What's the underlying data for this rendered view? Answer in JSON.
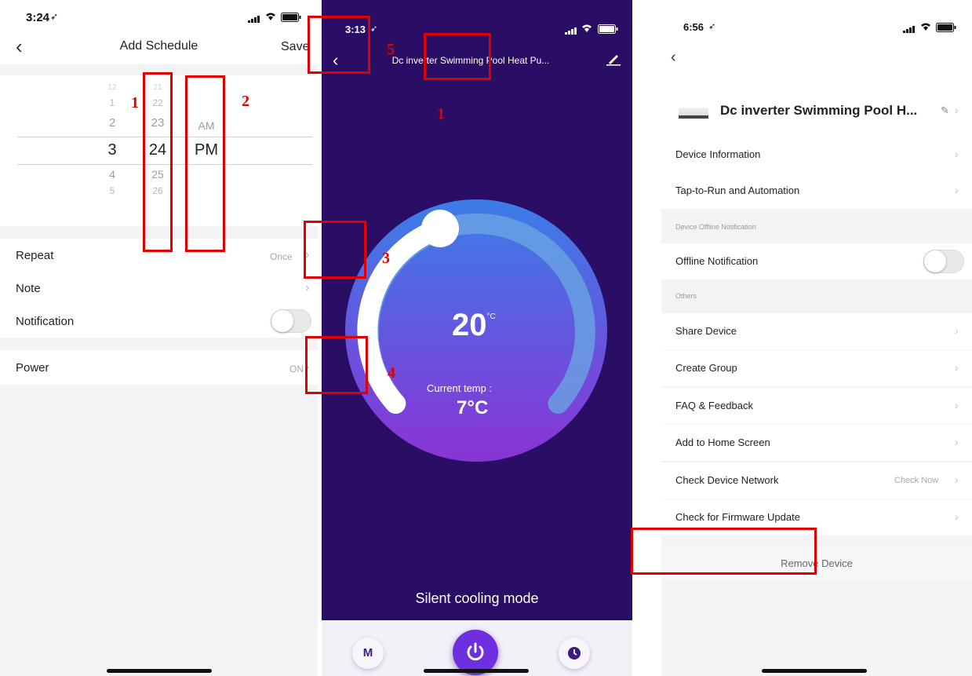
{
  "schedule_screen": {
    "status_time": "3:24",
    "title": "Add Schedule",
    "save_label": "Save",
    "hour_wheel": [
      "1",
      "2",
      "3",
      "4",
      "5"
    ],
    "minute_wheel": [
      "22",
      "23",
      "24",
      "25",
      "26"
    ],
    "ampm_wheel": [
      "AM",
      "PM"
    ],
    "selected": {
      "hour": "3",
      "minute": "24",
      "ampm": "PM"
    },
    "rows": {
      "repeat_label": "Repeat",
      "repeat_value": "Once",
      "note_label": "Note",
      "notification_label": "Notification",
      "power_label": "Power",
      "power_value": "ON"
    }
  },
  "control_screen": {
    "status_time": "3:13",
    "title": "Dc inverter Swimming Pool Heat Pu...",
    "set_temperature": "20",
    "set_temperature_unit": "°C",
    "current_temp_label": "Current temp :",
    "current_temp_value": "7°C",
    "mode_text": "Silent cooling mode",
    "mode_button_label": "M",
    "colors": {
      "background": "#2a0e66",
      "dial_top": "#3b7ee8",
      "dial_bottom": "#8a33d6",
      "power_button": "#6d2fe0"
    }
  },
  "settings_screen": {
    "status_time": "6:56",
    "device_name": "Dc inverter Swimming Pool H...",
    "menu": {
      "device_information": "Device Information",
      "tap_to_run": "Tap-to-Run and Automation",
      "section_offline": "Device Offline Notification",
      "offline_notification": "Offline Notification",
      "section_others": "Others",
      "share_device": "Share Device",
      "create_group": "Create Group",
      "faq_feedback": "FAQ & Feedback",
      "add_to_home": "Add to Home Screen",
      "check_network": "Check Device Network",
      "check_network_value": "Check Now",
      "check_firmware": "Check for Firmware Update",
      "remove_device": "Remove Device"
    }
  },
  "annotations": {
    "labels": [
      "1",
      "2",
      "5",
      "1",
      "3",
      "4"
    ],
    "box_color": "#e00000"
  }
}
